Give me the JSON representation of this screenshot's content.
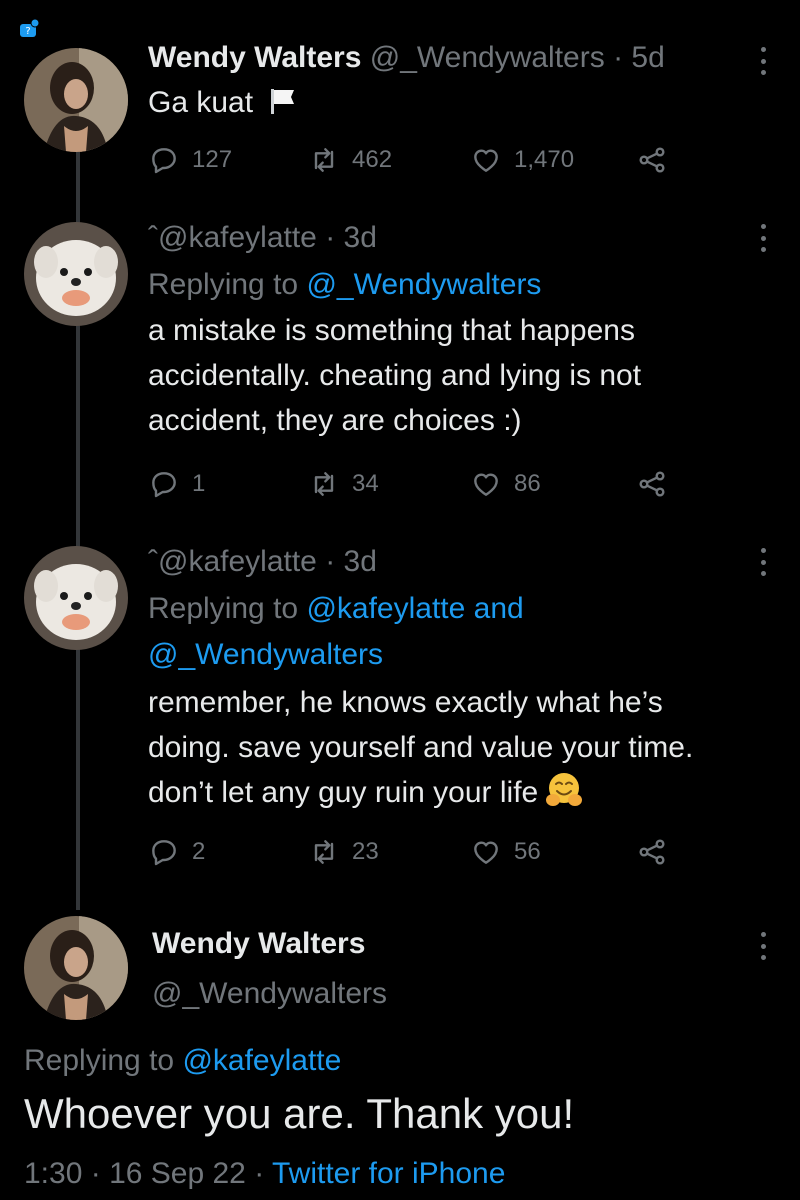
{
  "tweets": [
    {
      "name": "Wendy Walters",
      "handle": "@_Wendywalters",
      "sep": " · ",
      "time": "5d",
      "text": "Ga kuat",
      "flag_icon": "white-flag-icon",
      "replies": "127",
      "retweets": "462",
      "likes": "1,470"
    },
    {
      "name_mark": "ˆ",
      "handle": "@kafeylatte",
      "sep": " · ",
      "time": "3d",
      "replying_prefix": "Replying to ",
      "replying_to": "@_Wendywalters",
      "text_lines": [
        "a mistake is something that happens",
        "accidentally. cheating and lying is not",
        "accident, they are choices :)"
      ],
      "replies": "1",
      "retweets": "34",
      "likes": "86"
    },
    {
      "name_mark": "ˆ",
      "handle": "@kafeylatte",
      "sep": " · ",
      "time": "3d",
      "replying_prefix": "Replying to ",
      "replying_to_1": "@kafeylatte",
      "replying_and": " and",
      "replying_to_2": "@_Wendywalters",
      "text_lines": [
        "remember, he knows exactly what he’s",
        "doing. save yourself and value your time.",
        "don’t let any guy ruin your life"
      ],
      "emoji": "hugging-face-emoji",
      "replies": "2",
      "retweets": "23",
      "likes": "56"
    }
  ],
  "main_tweet": {
    "name": "Wendy Walters",
    "handle": "@_Wendywalters",
    "replying_prefix": "Replying to ",
    "replying_to": "@kafeylatte",
    "text": "Whoever you are. Thank you!",
    "time": "1:30",
    "sep": " · ",
    "date": "16 Sep 22",
    "source": "Twitter for iPhone"
  },
  "icons": {
    "reply": "reply-icon",
    "retweet": "retweet-icon",
    "like": "like-icon",
    "share": "share-icon",
    "more": "more-icon"
  },
  "colors": {
    "background": "#000000",
    "text": "#e7e9ea",
    "muted": "#71767b",
    "link": "#1d9bf0"
  }
}
